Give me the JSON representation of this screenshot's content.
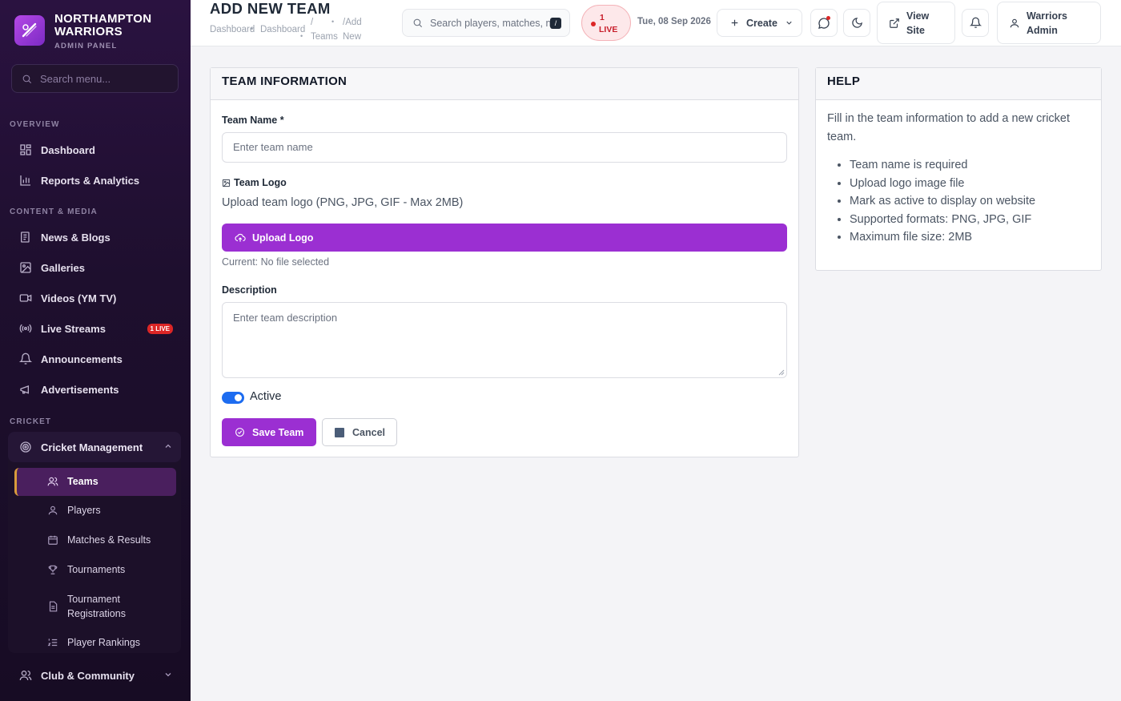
{
  "brand": {
    "name_line1": "NORTHAMPTON",
    "name_line2": "WARRIORS",
    "subtitle": "ADMIN PANEL"
  },
  "sidebar": {
    "search_placeholder": "Search menu...",
    "sections": {
      "overview": "OVERVIEW",
      "content": "CONTENT & MEDIA",
      "cricket": "CRICKET"
    },
    "items": {
      "dashboard": "Dashboard",
      "reports": "Reports & Analytics",
      "news": "News & Blogs",
      "galleries": "Galleries",
      "videos": "Videos (YM TV)",
      "live": "Live Streams",
      "live_badge": "1 LIVE",
      "announcements": "Announcements",
      "advertisements": "Advertisements",
      "cricket_mgmt": "Cricket Management",
      "club": "Club & Community"
    },
    "sub_items": {
      "teams": "Teams",
      "players": "Players",
      "matches": "Matches & Results",
      "tournaments": "Tournaments",
      "registrations_1": "Tournament",
      "registrations_2": "Registrations",
      "rankings": "Player Rankings"
    }
  },
  "header": {
    "title": "ADD NEW TEAM",
    "breadcrumb": {
      "dashboard_1": "Dashboard",
      "dashboard_2": "Dashboard",
      "sep": "/",
      "teams": "Teams",
      "add": "/Add",
      "new": "New"
    },
    "search_placeholder": "Search players, matches, n",
    "search_shortcut": "/",
    "live_count": "1",
    "live_label": "LIVE",
    "date": "Tue, 08 Sep 2026",
    "create_label": "Create",
    "view_site_1": "View",
    "view_site_2": "Site",
    "user_1": "Warriors",
    "user_2": "Admin"
  },
  "form": {
    "section_title": "TEAM INFORMATION",
    "team_name_label": "Team Name *",
    "team_name_placeholder": "Enter team name",
    "team_logo_label": "Team Logo",
    "team_logo_hint": "Upload team logo (PNG, JPG, GIF - Max 2MB)",
    "upload_label": "Upload Logo",
    "current_file": "Current: No file selected",
    "description_label": "Description",
    "description_placeholder": "Enter team description",
    "active_label": "Active",
    "active": true,
    "save_label": "Save Team",
    "cancel_label": "Cancel"
  },
  "help": {
    "title": "HELP",
    "intro": "Fill in the team information to add a new cricket team.",
    "items": [
      "Team name is required",
      "Upload logo image file",
      "Mark as active to display on website",
      "Supported formats: PNG, JPG, GIF",
      "Maximum file size: 2MB"
    ]
  },
  "colors": {
    "accent": "#9b2fd2",
    "sidebar": "#1e0f2e",
    "live": "#dc2626",
    "toggle": "#1d6cf0"
  }
}
